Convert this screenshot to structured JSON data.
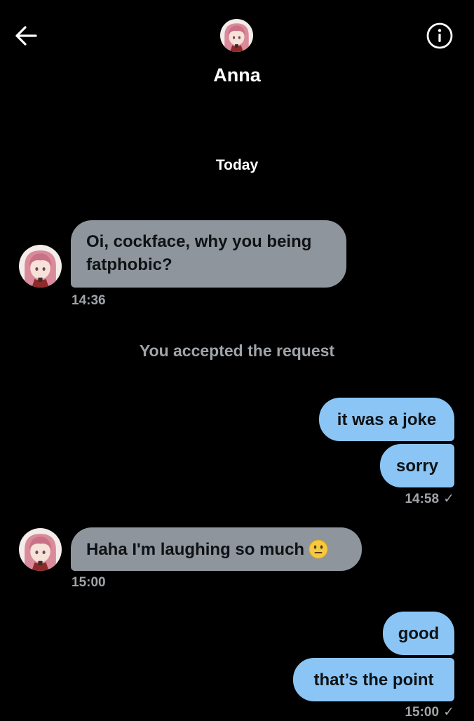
{
  "header": {
    "contact_name": "Anna",
    "back_icon": "arrow-left-icon",
    "info_icon": "info-circle-icon",
    "avatar_icon": "contact-avatar"
  },
  "date_separator": "Today",
  "system_message": "You accepted the request",
  "colors": {
    "background": "#000000",
    "incoming_bubble": "#8f959c",
    "outgoing_bubble": "#8ac5f5",
    "timestamp": "#a0a4a8",
    "text_on_bubble": "#0f1215"
  },
  "messages": {
    "m1": {
      "direction": "incoming",
      "text": "Oi, cockface, why you being fatphobic?",
      "time": "14:36"
    },
    "m2": {
      "direction": "outgoing",
      "text": "it was a joke"
    },
    "m3": {
      "direction": "outgoing",
      "text": "sorry",
      "time": "14:58",
      "read_icon": "check-icon"
    },
    "m4": {
      "direction": "incoming",
      "text": "Haha I'm laughing so much",
      "emoji": "neutral-face-emoji",
      "time": "15:00"
    },
    "m5": {
      "direction": "outgoing",
      "text": "good"
    },
    "m6": {
      "direction": "outgoing",
      "text": "that’s the point",
      "time": "15:00",
      "read_icon": "check-icon"
    }
  },
  "status_marks": {
    "read_check": "✓"
  }
}
